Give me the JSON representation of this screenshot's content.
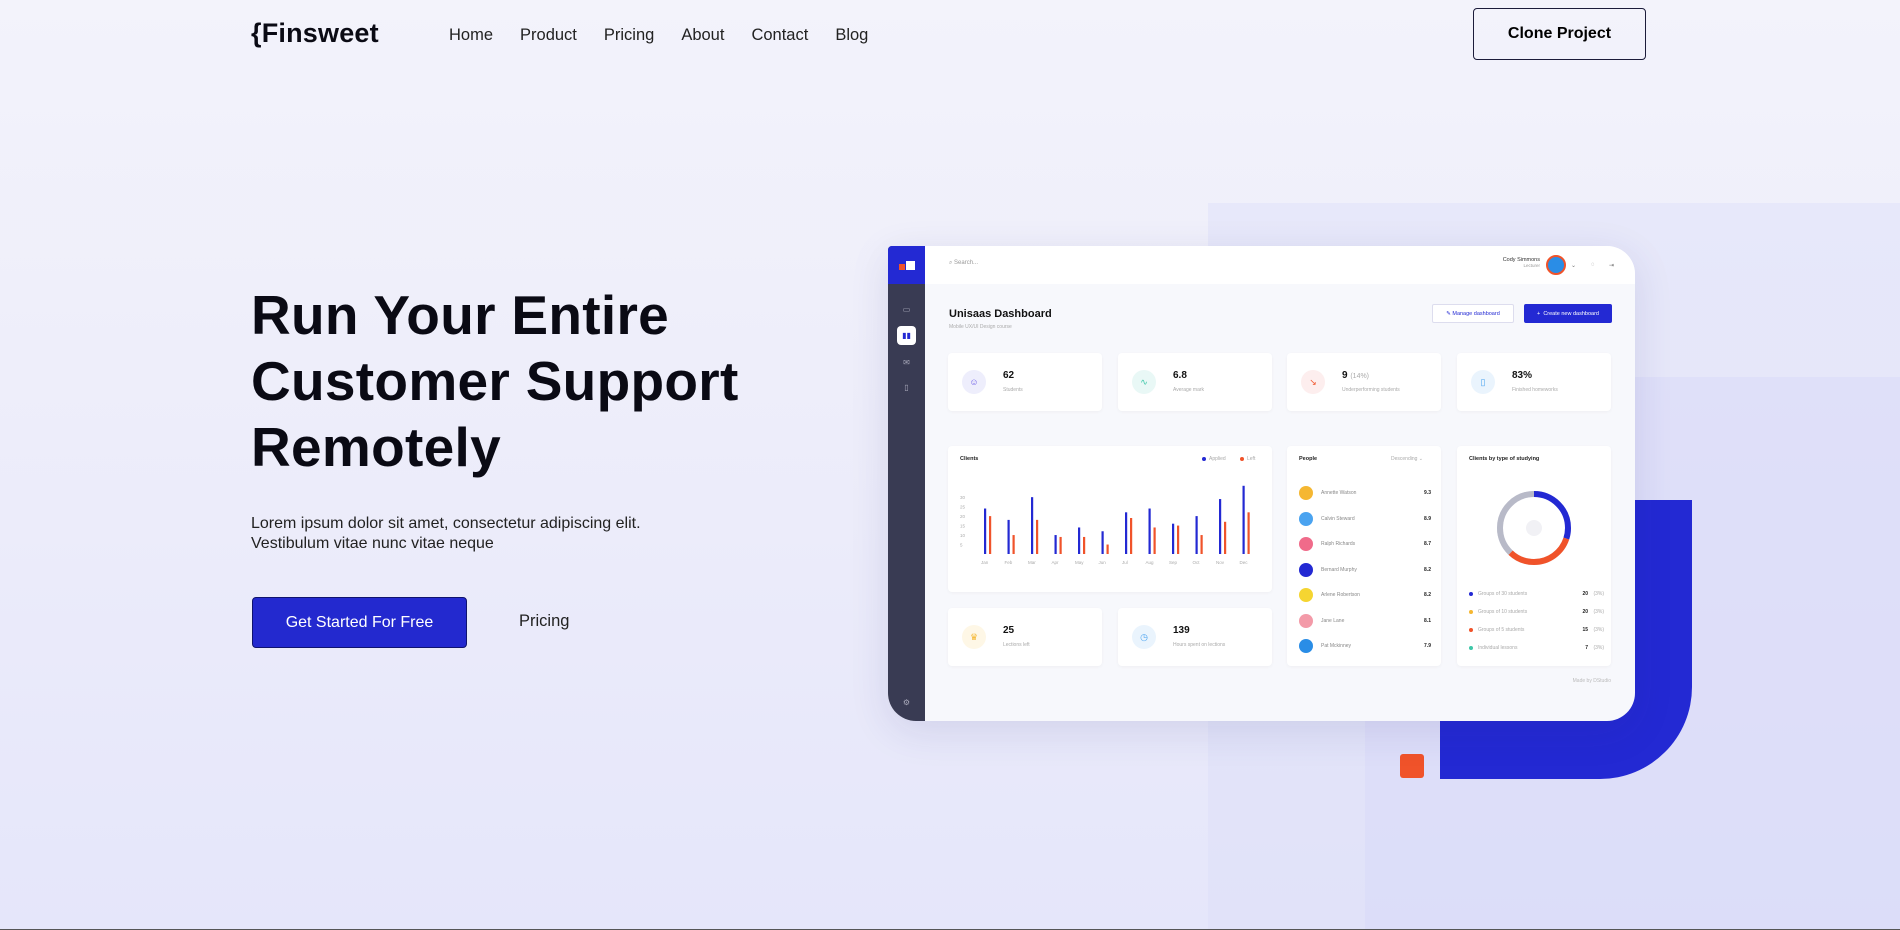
{
  "nav": {
    "logo": "{Finsweet",
    "links": [
      "Home",
      "Product",
      "Pricing",
      "About",
      "Contact",
      "Blog"
    ],
    "clone_label": "Clone Project"
  },
  "hero": {
    "title_lines": [
      "Run Your Entire",
      "Customer Support",
      "Remotely"
    ],
    "sub_lines": [
      "Lorem ipsum dolor sit amet, consectetur adipiscing elit.",
      "Vestibulum vitae nunc vitae neque"
    ],
    "cta": "Get Started For Free",
    "secondary": "Pricing"
  },
  "colors": {
    "accent": "#2329d3",
    "orange": "#f0532a",
    "sidebar": "#393b53"
  },
  "dashboard": {
    "search": "Search...",
    "user_name": "Cody Simmons",
    "user_role": "Lecturer",
    "title": "Unisaas Dashboard",
    "subtitle": "Mobile UX/UI Design course",
    "manage": "Manage dashboard",
    "create": "Create new dashboard",
    "stats": [
      {
        "value": "62",
        "extra": "",
        "label": "Students",
        "icon": "user-icon"
      },
      {
        "value": "6.8",
        "extra": "",
        "label": "Average mark",
        "icon": "trend-icon"
      },
      {
        "value": "9",
        "extra": "(14%)",
        "label": "Underperforming students",
        "icon": "trend-down-icon"
      },
      {
        "value": "83%",
        "extra": "",
        "label": "Finished homeworks",
        "icon": "book-icon"
      }
    ],
    "clients": {
      "title": "Clients",
      "legend": [
        "Applied",
        "Left"
      ]
    },
    "chart_data": {
      "type": "bar",
      "categories": [
        "Jan",
        "Feb",
        "Mar",
        "Apr",
        "May",
        "Jun",
        "Jul",
        "Aug",
        "Sep",
        "Oct",
        "Nov",
        "Dec"
      ],
      "yticks": [
        "30",
        "25",
        "20",
        "15",
        "10",
        "5"
      ],
      "series": [
        {
          "name": "Applied",
          "color": "#2329d3",
          "values": [
            24,
            18,
            30,
            10,
            14,
            12,
            22,
            24,
            16,
            20,
            29,
            36
          ]
        },
        {
          "name": "Left",
          "color": "#f0532a",
          "values": [
            20,
            10,
            18,
            9,
            9,
            5,
            19,
            14,
            15,
            10,
            17,
            22
          ]
        }
      ]
    },
    "people": {
      "title": "People",
      "sort": "Descending",
      "rows": [
        {
          "name": "Annette Watson",
          "score": "9.3",
          "color": "#f5b731"
        },
        {
          "name": "Calvin Steward",
          "score": "8.9",
          "color": "#4aa3f0"
        },
        {
          "name": "Ralph Richards",
          "score": "8.7",
          "color": "#f06b8a"
        },
        {
          "name": "Bernard Murphy",
          "score": "8.2",
          "color": "#2329d3"
        },
        {
          "name": "Arlene Robertson",
          "score": "8.2",
          "color": "#f5d531"
        },
        {
          "name": "Jane Lane",
          "score": "8.1",
          "color": "#f39aa8"
        },
        {
          "name": "Pat Mckinney",
          "score": "7.9",
          "color": "#2a8de6"
        }
      ]
    },
    "types": {
      "title": "Clients by type of studying",
      "rows": [
        {
          "label": "Groups of 30 students",
          "count": "20",
          "unit": "(3%)",
          "color": "#2329d3"
        },
        {
          "label": "Groups of 10 students",
          "count": "20",
          "unit": "(3%)",
          "color": "#f5b731"
        },
        {
          "label": "Groups of 5 students",
          "count": "15",
          "unit": "(3%)",
          "color": "#f0532a"
        },
        {
          "label": "Individual lessons",
          "count": "7",
          "unit": "(3%)",
          "color": "#3ec7a8"
        }
      ]
    },
    "extra_stats": [
      {
        "value": "25",
        "label": "Lections left",
        "icon": "trophy-icon"
      },
      {
        "value": "139",
        "label": "Hours spent on lections",
        "icon": "clock-icon"
      }
    ],
    "credit": "Made by DStudio"
  }
}
